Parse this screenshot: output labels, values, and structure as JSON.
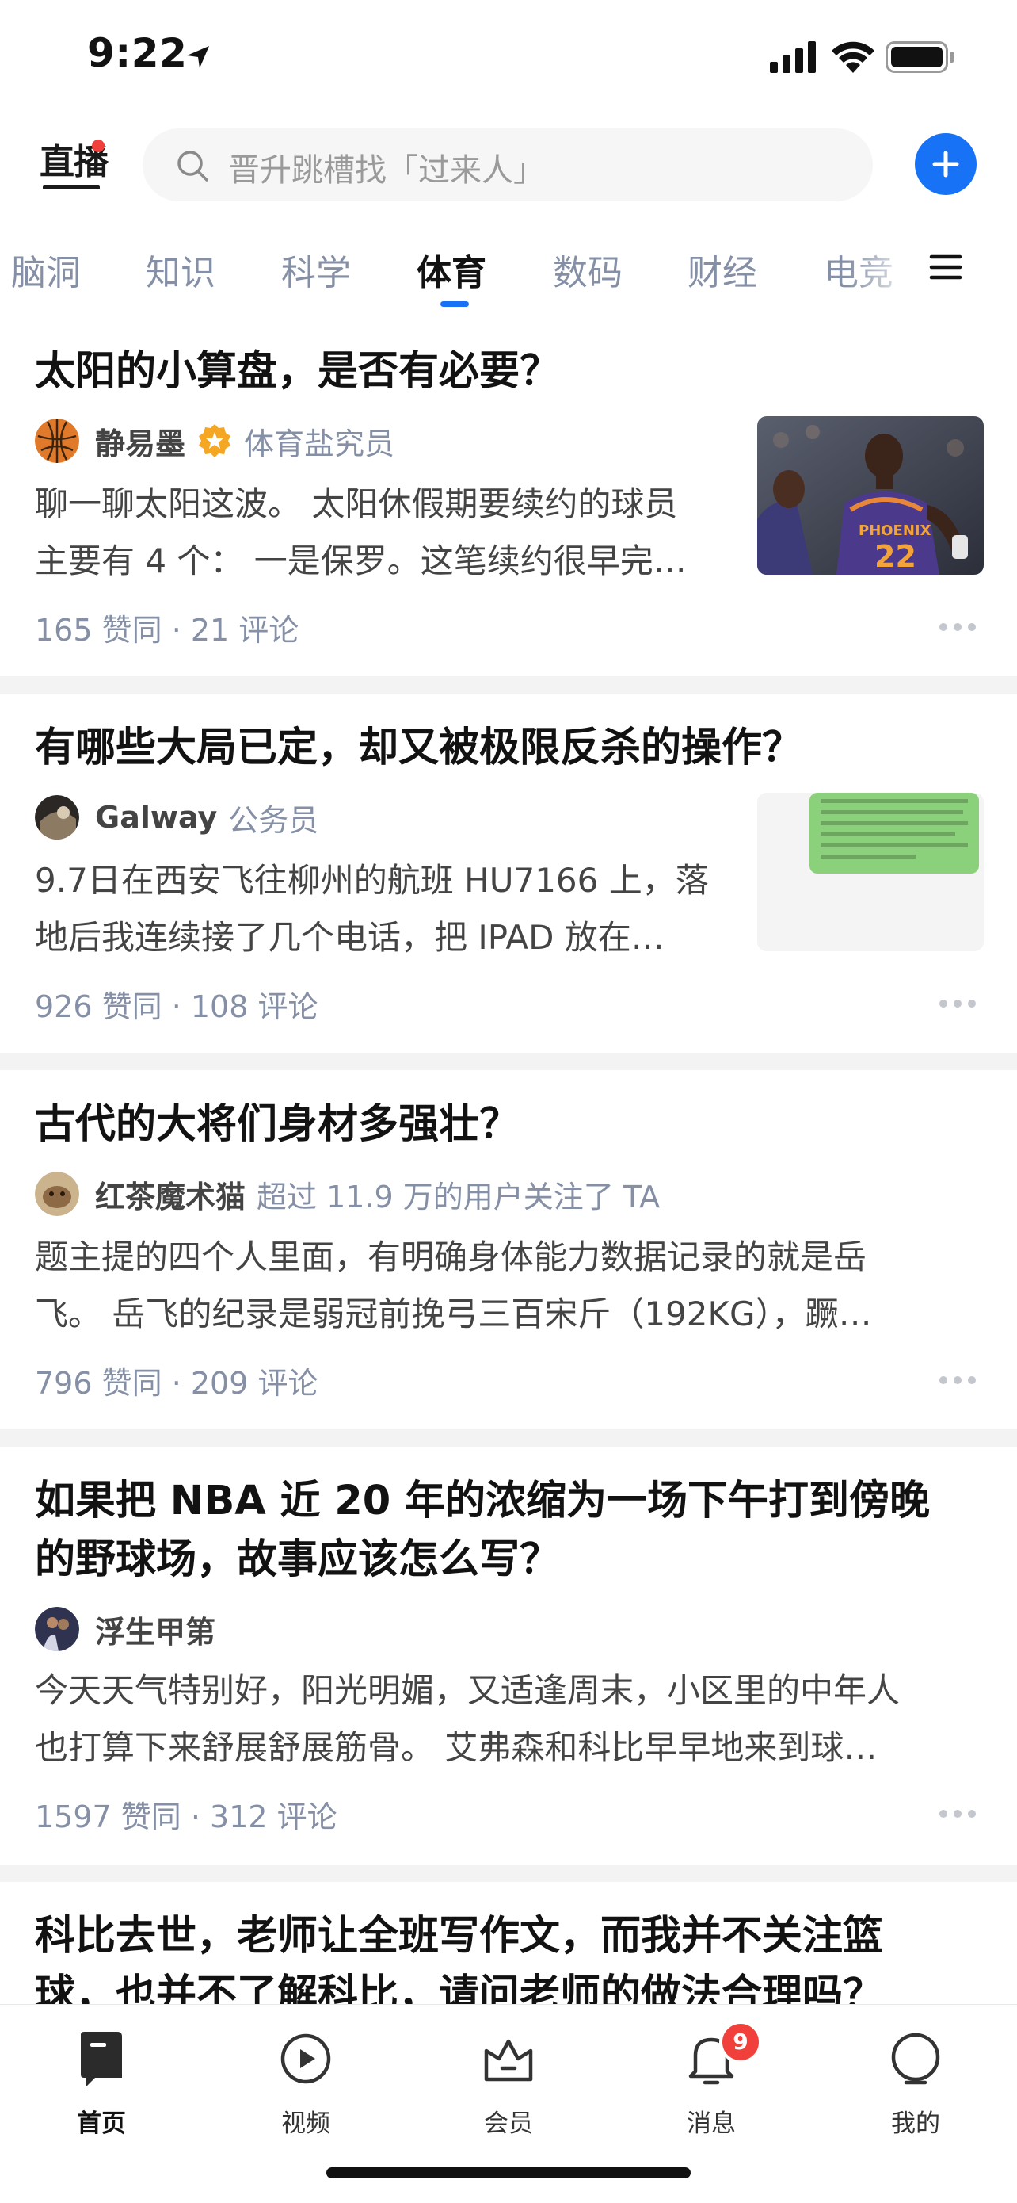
{
  "status_bar": {
    "time": "9:22"
  },
  "header": {
    "live_label": "直播",
    "search_placeholder": "晋升跳槽找「过来人」"
  },
  "tabs": [
    {
      "label": "脑洞",
      "active": false
    },
    {
      "label": "知识",
      "active": false
    },
    {
      "label": "科学",
      "active": false
    },
    {
      "label": "体育",
      "active": true
    },
    {
      "label": "数码",
      "active": false
    },
    {
      "label": "财经",
      "active": false
    },
    {
      "label": "电竞",
      "active": false
    }
  ],
  "feed": [
    {
      "title": "太阳的小算盘，是否有必要？",
      "author": "静易墨",
      "author_desc": "体育盐究员",
      "excerpt_lines": [
        "聊一聊太阳这波。 太阳休假期要续约的球员",
        "主要有 4 个： 一是保罗。这笔续约很早完…"
      ],
      "meta": "165 赞同 · 21 评论",
      "has_thumbnail": true
    },
    {
      "title": "有哪些大局已定，却又被极限反杀的操作？",
      "author": "Galway",
      "author_desc": "公务员",
      "excerpt_lines": [
        "9.7日在西安飞往柳州的航班 HU7166 上，落",
        "地后我连续接了几个电话，把 IPAD 放在…"
      ],
      "meta": "926 赞同 · 108 评论",
      "has_thumbnail": true
    },
    {
      "title": "古代的大将们身材多强壮？",
      "author": "红茶魔术猫",
      "author_desc": "超过 11.9 万的用户关注了 TA",
      "excerpt_lines": [
        "题主提的四个人里面，有明确身体能力数据记录的就是岳",
        "飞。 岳飞的纪录是弱冠前挽弓三百宋斤（192KG），蹶…"
      ],
      "meta": "796 赞同 · 209 评论",
      "has_thumbnail": false
    },
    {
      "title_lines": [
        "如果把 NBA 近 20 年的浓缩为一场下午打到傍晚",
        "的野球场，故事应该怎么写？"
      ],
      "author": "浮生甲第",
      "excerpt_lines": [
        "今天天气特别好，阳光明媚，又适逢周末，小区里的中年人",
        "也打算下来舒展舒展筋骨。 艾弗森和科比早早地来到球…"
      ],
      "meta": "1597 赞同 · 312 评论",
      "has_thumbnail": false
    },
    {
      "title_lines": [
        "科比去世，老师让全班写作文，而我并不关注篮",
        "球，也并不了解科比，请问老师的做法合理吗？"
      ]
    }
  ],
  "bottom_nav": [
    {
      "label": "首页",
      "icon": "home-icon",
      "active": true
    },
    {
      "label": "视频",
      "icon": "video-icon",
      "active": false
    },
    {
      "label": "会员",
      "icon": "member-icon",
      "active": false
    },
    {
      "label": "消息",
      "icon": "bell-icon",
      "active": false,
      "badge": "9"
    },
    {
      "label": "我的",
      "icon": "profile-icon",
      "active": false
    }
  ],
  "colors": {
    "brand_blue": "#1772f6",
    "badge_red": "#f1403c",
    "meta_gray": "#8590a6"
  }
}
